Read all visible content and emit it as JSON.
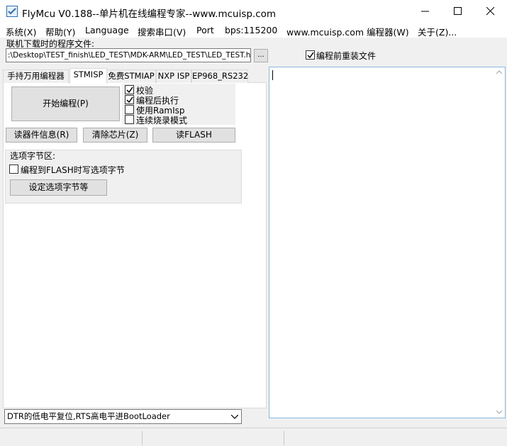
{
  "window": {
    "title": "FlyMcu V0.188--单片机在线编程专家--www.mcuisp.com",
    "controls": {
      "minimize_icon": "minimize-icon",
      "maximize_icon": "maximize-icon",
      "close_icon": "close-icon"
    }
  },
  "menu": {
    "items": [
      {
        "label": "系统(X)"
      },
      {
        "label": "帮助(Y)"
      },
      {
        "label": "Language"
      },
      {
        "label": "搜索串口(V)"
      },
      {
        "label": "Port"
      },
      {
        "label": "bps:115200"
      },
      {
        "label": "www.mcuisp.com 编程器(W)"
      },
      {
        "label": "关于(Z)..."
      }
    ]
  },
  "file": {
    "label": "联机下载时的程序文件:",
    "path": ":\\Desktop\\TEST_finish\\LED_TEST\\MDK-ARM\\LED_TEST\\LED_TEST.hex",
    "browse_label": "...",
    "reload_label": "编程前重装文件",
    "reload_checked": true
  },
  "tabs": [
    {
      "label": "手持万用编程器"
    },
    {
      "label": "STMISP"
    },
    {
      "label": "免费STMIAP"
    },
    {
      "label": "NXP ISP"
    },
    {
      "label": "EP968_RS232"
    }
  ],
  "active_tab": "STMISP",
  "stmisp": {
    "start_button": "开始编程(P)",
    "options": [
      {
        "label": "校验",
        "checked": true
      },
      {
        "label": "编程后执行",
        "checked": true
      },
      {
        "label": "使用RamIsp",
        "checked": false
      },
      {
        "label": "连续烧录模式",
        "checked": false
      }
    ],
    "read_info_button": "读器件信息(R)",
    "erase_button": "清除芯片(Z)",
    "read_flash_button": "读FLASH",
    "option_bytes": {
      "title": "选项字节区:",
      "write_label": "编程到FLASH时写选项字节",
      "write_checked": false,
      "set_button": "设定选项字节等"
    }
  },
  "reset_mode": {
    "selected": "DTR的低电平复位,RTS高电平进BootLoader"
  },
  "output": {
    "text": ""
  },
  "colors": {
    "accent": "#2a6fb5",
    "output_border": "#8ab8e0"
  }
}
